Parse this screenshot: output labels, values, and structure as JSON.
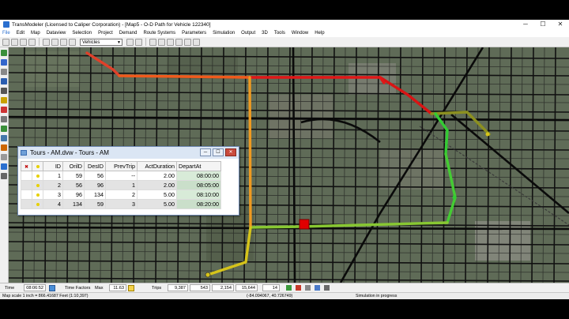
{
  "window": {
    "title": "TransModeler (Licensed to Caliper Corporation) - [Map5 - O-D Path for Vehicle 122340]",
    "minimize_glyph": "─",
    "maximize_glyph": "☐",
    "close_glyph": "✕"
  },
  "menu": {
    "items": [
      "File",
      "Edit",
      "Map",
      "Dataview",
      "Selection",
      "Project",
      "Demand",
      "Route Systems",
      "Parameters",
      "Simulation",
      "Output",
      "3D",
      "Tools",
      "Window",
      "Help"
    ]
  },
  "toolbar": {
    "layer_value": "Vehicles",
    "icons": [
      "new-file-icon",
      "open-folder-icon",
      "save-icon",
      "print-icon",
      "cut-icon",
      "copy-icon",
      "paste-icon",
      "undo-icon",
      "layers-icon",
      "legend-icon",
      "zoom-in-icon",
      "zoom-out-icon",
      "pan-icon",
      "select-icon",
      "info-icon",
      "route-icon"
    ]
  },
  "tool_palette": {
    "icons": [
      "signal-icon",
      "zoom-icon",
      "pan-icon",
      "node-icon",
      "link-icon",
      "sensor-icon",
      "vehicle-icon",
      "camera-icon",
      "flag-icon",
      "chart-icon",
      "path-icon",
      "detector-icon",
      "info-icon",
      "settings-icon"
    ]
  },
  "tours_window": {
    "title": "Tours - AM.dvw - Tours - AM",
    "columns": [
      "ID",
      "OrilD",
      "DesID",
      "PrevTrip",
      "ActDuration",
      "DepartAt"
    ],
    "rows": [
      [
        "1",
        "59",
        "56",
        "--",
        "2.00",
        "08:00:00"
      ],
      [
        "2",
        "56",
        "96",
        "1",
        "2.00",
        "08:05:00"
      ],
      [
        "3",
        "96",
        "134",
        "2",
        "5.00",
        "08:10:00"
      ],
      [
        "4",
        "134",
        "59",
        "3",
        "5.00",
        "08:20:00"
      ]
    ]
  },
  "sim_bar": {
    "time_label": "Time",
    "time_value": "08:06:52",
    "time_factors_label": "Time Factors",
    "max_label": "Max",
    "max_value": "11.63",
    "trips_label": "Trips",
    "trips_value": "9,387",
    "count_a": "543",
    "count_b": "2,154",
    "count_c": "15,644",
    "count_d": "14"
  },
  "status": {
    "scale": "Map scale 1 inch = 866.41687 Feet (1:10,397)",
    "coords": "(-84.094067, 40.726749)",
    "state": "Simulation in progress"
  },
  "colors": {
    "path_start": "#e0402a",
    "path_mid_red": "#e01818",
    "path_orange": "#f09a20",
    "path_yellow": "#d6c41a",
    "path_green": "#33cc33",
    "stop_marker": "#e00000",
    "imagery_base": "#5d6a55",
    "road": "#111111"
  }
}
